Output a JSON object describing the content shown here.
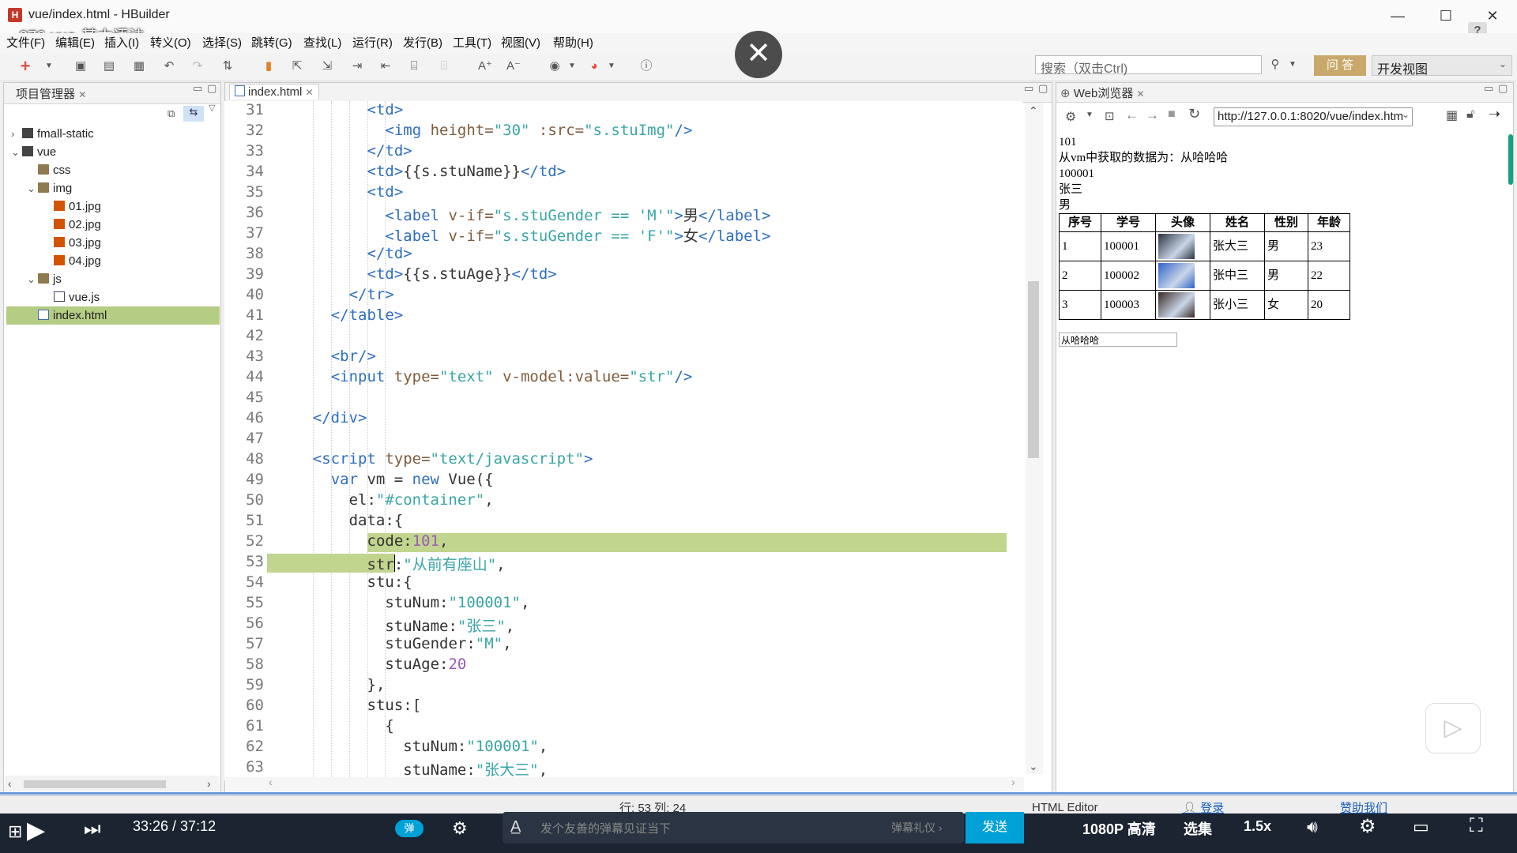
{
  "window": {
    "title": "vue/index.html  -  HBuilder",
    "icon": "H",
    "video_title": "076-vue-基本语法",
    "minimize": "—",
    "maximize": "☐",
    "close": "✕"
  },
  "menu": [
    "文件(F)",
    "编辑(E)",
    "插入(I)",
    "转义(O)",
    "选择(S)",
    "跳转(G)",
    "查找(L)",
    "运行(R)",
    "发行(B)",
    "工具(T)",
    "视图(V)",
    "帮助(H)"
  ],
  "overlay_close": "✕",
  "search": {
    "placeholder": "搜索（双击Ctrl)"
  },
  "ask_button": "问 答",
  "view_select": "开发视图",
  "project": {
    "tab": "项目管理器",
    "tree": [
      {
        "label": "fmall-static",
        "depth": 0,
        "arrow": "›",
        "icon": "proj"
      },
      {
        "label": "vue",
        "depth": 0,
        "arrow": "⌄",
        "icon": "proj"
      },
      {
        "label": "css",
        "depth": 1,
        "arrow": "",
        "icon": "fold"
      },
      {
        "label": "img",
        "depth": 1,
        "arrow": "⌄",
        "icon": "fold"
      },
      {
        "label": "01.jpg",
        "depth": 2,
        "arrow": "",
        "icon": "img-ic"
      },
      {
        "label": "02.jpg",
        "depth": 2,
        "arrow": "",
        "icon": "img-ic"
      },
      {
        "label": "03.jpg",
        "depth": 2,
        "arrow": "",
        "icon": "img-ic"
      },
      {
        "label": "04.jpg",
        "depth": 2,
        "arrow": "",
        "icon": "img-ic"
      },
      {
        "label": "js",
        "depth": 1,
        "arrow": "⌄",
        "icon": "fold"
      },
      {
        "label": "vue.js",
        "depth": 2,
        "arrow": "",
        "icon": "js-ic"
      },
      {
        "label": "index.html",
        "depth": 1,
        "arrow": "",
        "icon": "html-ic",
        "selected": true
      }
    ]
  },
  "editor": {
    "tab": "index.html",
    "lines": [
      {
        "n": "31",
        "indent": 10,
        "html": "<span class='tag'>&lt;td&gt;</span>"
      },
      {
        "n": "32",
        "indent": 12,
        "html": "<span class='tag'>&lt;img</span> <span class='attr'>height=</span><span class='str'>\"30\"</span> <span class='attr'>:src=</span><span class='str'>\"s.stuImg\"</span><span class='tag'>/&gt;</span>"
      },
      {
        "n": "33",
        "indent": 10,
        "html": "<span class='tag'>&lt;/td&gt;</span>"
      },
      {
        "n": "34",
        "indent": 10,
        "html": "<span class='tag'>&lt;td&gt;</span>{{s.stuName}}<span class='tag'>&lt;/td&gt;</span>"
      },
      {
        "n": "35",
        "indent": 10,
        "html": "<span class='tag'>&lt;td&gt;</span>"
      },
      {
        "n": "36",
        "indent": 12,
        "html": "<span class='tag'>&lt;label</span> <span class='attr'>v-if=</span><span class='str'>\"s.stuGender == 'M'\"</span><span class='tag'>&gt;</span>男<span class='tag'>&lt;/label&gt;</span>"
      },
      {
        "n": "37",
        "indent": 12,
        "html": "<span class='tag'>&lt;label</span> <span class='attr'>v-if=</span><span class='str'>\"s.stuGender == 'F'\"</span><span class='tag'>&gt;</span>女<span class='tag'>&lt;/label&gt;</span>"
      },
      {
        "n": "38",
        "indent": 10,
        "html": "<span class='tag'>&lt;/td&gt;</span>"
      },
      {
        "n": "39",
        "indent": 10,
        "html": "<span class='tag'>&lt;td&gt;</span>{{s.stuAge}}<span class='tag'>&lt;/td&gt;</span>"
      },
      {
        "n": "40",
        "indent": 8,
        "html": "<span class='tag'>&lt;/tr&gt;</span>"
      },
      {
        "n": "41",
        "indent": 6,
        "html": "<span class='tag'>&lt;/table&gt;</span>"
      },
      {
        "n": "42",
        "indent": 0,
        "html": ""
      },
      {
        "n": "43",
        "indent": 6,
        "html": "<span class='tag'>&lt;br/&gt;</span>"
      },
      {
        "n": "44",
        "indent": 6,
        "html": "<span class='tag'>&lt;input</span> <span class='attr'>type=</span><span class='str'>\"text\"</span> <span class='attr'>v-model:value=</span><span class='str'>\"str\"</span><span class='tag'>/&gt;</span>"
      },
      {
        "n": "45",
        "indent": 0,
        "html": ""
      },
      {
        "n": "46",
        "indent": 4,
        "html": "<span class='tag'>&lt;/div&gt;</span>"
      },
      {
        "n": "47",
        "indent": 0,
        "html": ""
      },
      {
        "n": "48",
        "indent": 4,
        "html": "<span class='tag'>&lt;script</span> <span class='attr'>type=</span><span class='str'>\"text/javascript\"</span><span class='tag'>&gt;</span>"
      },
      {
        "n": "49",
        "indent": 6,
        "html": "<span class='kw'>var</span> vm = <span class='kw'>new</span> Vue({"
      },
      {
        "n": "50",
        "indent": 8,
        "html": "el:<span class='str'>\"#container\"</span>,"
      },
      {
        "n": "51",
        "indent": 8,
        "html": "data:{"
      },
      {
        "n": "52",
        "indent": 10,
        "html": "code:<span class='num'>101</span>,"
      },
      {
        "n": "53",
        "indent": 10,
        "html": "str:<span class='str'>\"从前有座山\"</span>,"
      },
      {
        "n": "54",
        "indent": 10,
        "html": "stu:{"
      },
      {
        "n": "55",
        "indent": 12,
        "html": "stuNum:<span class='str'>\"100001\"</span>,"
      },
      {
        "n": "56",
        "indent": 12,
        "html": "stuName:<span class='str'>\"张三\"</span>,"
      },
      {
        "n": "57",
        "indent": 12,
        "html": "stuGender:<span class='str'>\"M\"</span>,"
      },
      {
        "n": "58",
        "indent": 12,
        "html": "stuAge:<span class='num'>20</span>"
      },
      {
        "n": "59",
        "indent": 10,
        "html": "},"
      },
      {
        "n": "60",
        "indent": 10,
        "html": "stus:["
      },
      {
        "n": "61",
        "indent": 12,
        "html": "{"
      },
      {
        "n": "62",
        "indent": 14,
        "html": "stuNum:<span class='str'>\"100001\"</span>,"
      },
      {
        "n": "63",
        "indent": 14,
        "html": "stuName:<span class='str'>\"张大三\"</span>,"
      }
    ]
  },
  "browser": {
    "tab": "Web浏览器",
    "url": "http://127.0.0.1:8020/vue/index.htm",
    "lines": [
      "101",
      "从vm中获取的数据为：从哈哈哈",
      "100001",
      "张三",
      "男"
    ],
    "table_headers": [
      "序号",
      "学号",
      "头像",
      "姓名",
      "性别",
      "年龄"
    ],
    "table_rows": [
      {
        "idx": "1",
        "num": "100001",
        "name": "张大三",
        "gender": "男",
        "age": "23",
        "thumb": "#2b3340"
      },
      {
        "idx": "2",
        "num": "100002",
        "name": "张中三",
        "gender": "男",
        "age": "22",
        "thumb": "#2f63c9"
      },
      {
        "idx": "3",
        "num": "100003",
        "name": "张小三",
        "gender": "女",
        "age": "20",
        "thumb": "#3a2a26"
      }
    ],
    "input_value": "从哈哈哈"
  },
  "status": {
    "cursor": "行: 53 列: 24",
    "editor_name": "HTML Editor",
    "login": "登录",
    "sponsor": "赞助我们"
  },
  "player": {
    "time": "33:26 / 37:12",
    "danmaku_placeholder": "发个友善的弹幕见证当下",
    "danmaku_etiquette": "弹幕礼仪 ›",
    "send": "发送",
    "quality": "1080P 高清",
    "episodes": "选集",
    "speed": "1.5x",
    "danmaku_toggle": "弹"
  }
}
